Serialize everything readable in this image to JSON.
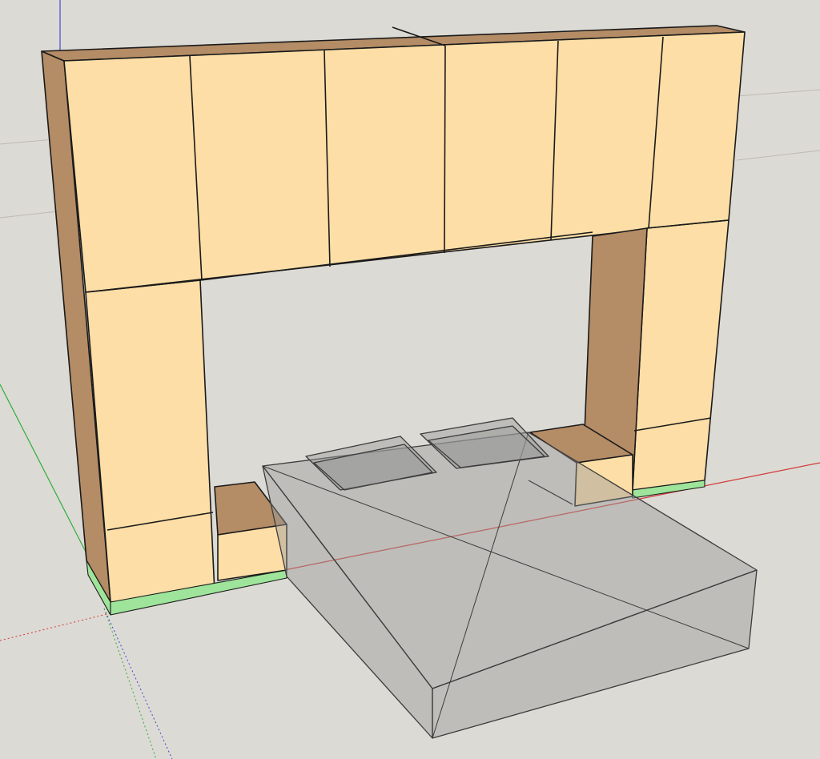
{
  "viewport": {
    "background": "#dcdad4",
    "grid_color": "#bdbab2"
  },
  "axes": {
    "red": "#d23a3a",
    "green": "#2fae3a",
    "blue": "#3a4bd6"
  },
  "materials": {
    "cabinet_front": "#fddea6",
    "cabinet_side": "#b48c66",
    "cabinet_top": "#b48c66",
    "plinth": "#9ee49a",
    "translucent_fill": "#9a9a9a",
    "edge": "#1a1a1a"
  },
  "model": {
    "components": [
      "wardrobe-bridge",
      "left-nightstand",
      "right-nightstand",
      "bed",
      "pillow-left",
      "pillow-right"
    ]
  }
}
